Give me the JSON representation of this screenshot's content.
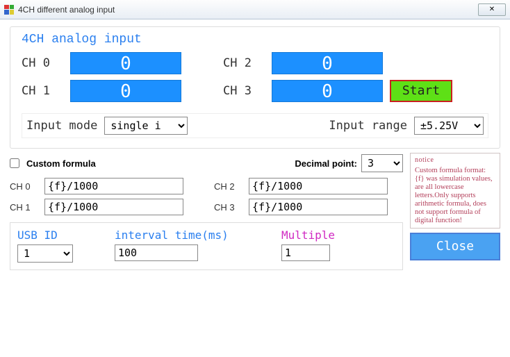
{
  "window": {
    "title": "4CH different analog input"
  },
  "group": {
    "title": "4CH analog input",
    "ch0_label": "CH 0",
    "ch0_value": "0",
    "ch1_label": "CH 1",
    "ch1_value": "0",
    "ch2_label": "CH 2",
    "ch2_value": "0",
    "ch3_label": "CH 3",
    "ch3_value": "0",
    "start": "Start",
    "input_mode_label": "Input mode",
    "input_mode_value": "single i",
    "input_range_label": "Input range",
    "input_range_value": "±5.25V"
  },
  "formula": {
    "checkbox_label": "Custom formula",
    "decimal_label": "Decimal point:",
    "decimal_value": "3",
    "ch0l": "CH 0",
    "ch0v": "{f}/1000",
    "ch1l": "CH 1",
    "ch1v": "{f}/1000",
    "ch2l": "CH 2",
    "ch2v": "{f}/1000",
    "ch3l": "CH 3",
    "ch3v": "{f}/1000"
  },
  "bottom": {
    "usb_label": "USB ID",
    "usb_value": "1",
    "interval_label": "interval time(ms)",
    "interval_value": "100",
    "multiple_label": "Multiple",
    "multiple_value": "1"
  },
  "notice": {
    "title": "notice",
    "text": "Custom formula format: {f} was simulation values, are all lowercase letters.Only supports arithmetic formula, does not support formula of digital function!"
  },
  "close": "Close"
}
